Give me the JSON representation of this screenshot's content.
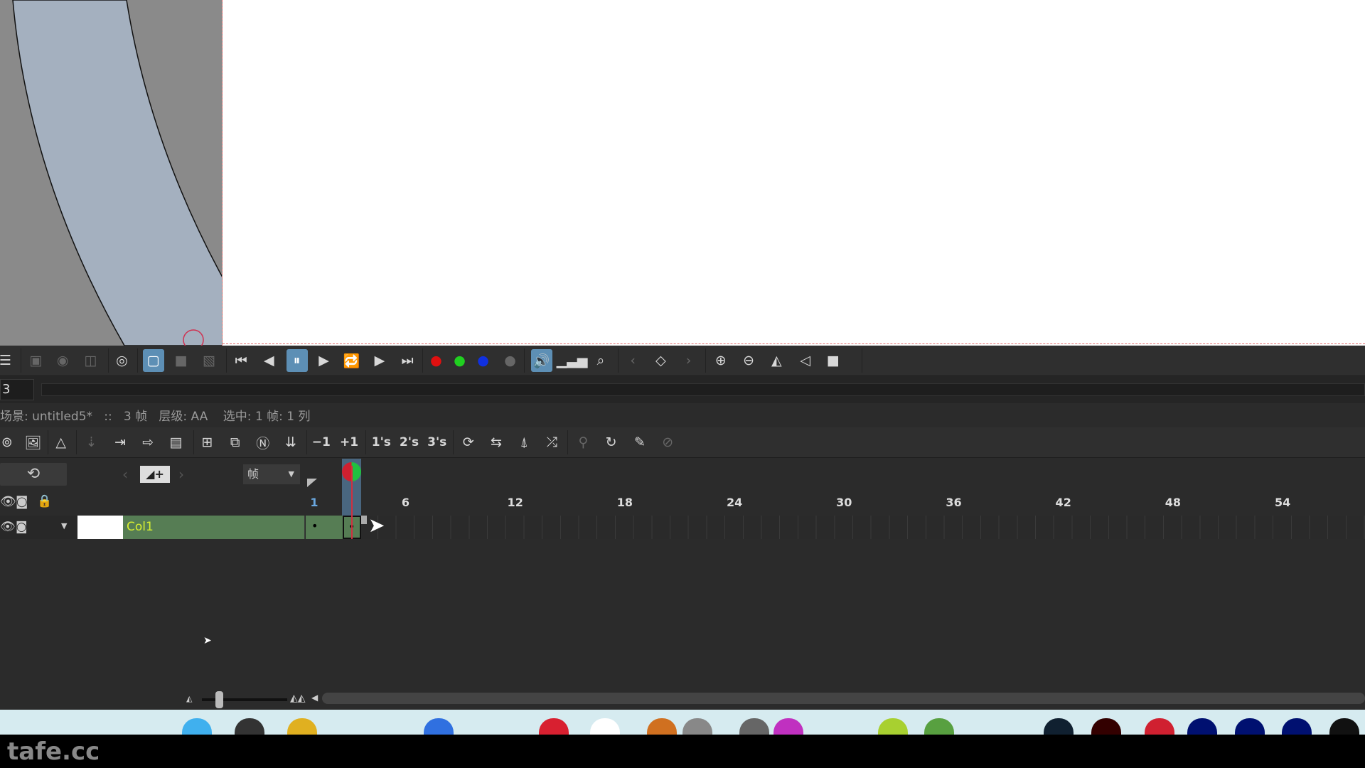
{
  "toolbar_main": [
    {
      "icon": "menu-icon",
      "g": "☰"
    },
    {
      "icon": "save-icon",
      "g": "▣",
      "dim": true
    },
    {
      "icon": "camera-icon",
      "g": "◉",
      "dim": true
    },
    {
      "icon": "compare-icon",
      "g": "◫",
      "dim": true
    },
    {
      "icon": "preview-icon",
      "g": "◎"
    },
    {
      "icon": "camera-view-icon",
      "g": "▢",
      "active": true,
      "dim": true
    },
    {
      "icon": "square-icon",
      "g": "■",
      "dim": true
    },
    {
      "icon": "sub-camera-icon",
      "g": "▧",
      "dim": true
    },
    {
      "icon": "first-frame-icon",
      "g": "⏮"
    },
    {
      "icon": "prev-frame-icon",
      "g": "◀"
    },
    {
      "icon": "pause-icon",
      "g": "⏸",
      "active": true
    },
    {
      "icon": "play-icon",
      "g": "▶"
    },
    {
      "icon": "loop-icon",
      "g": "🔁"
    },
    {
      "icon": "next-frame-icon",
      "g": "▶"
    },
    {
      "icon": "last-frame-icon",
      "g": "⏭"
    },
    {
      "icon": "red-channel-icon",
      "g": "●",
      "color": "#e01010"
    },
    {
      "icon": "green-channel-icon",
      "g": "●",
      "color": "#20d020"
    },
    {
      "icon": "blue-channel-icon",
      "g": "●",
      "color": "#1030e0"
    },
    {
      "icon": "alpha-channel-icon",
      "g": "●",
      "dim": true
    },
    {
      "icon": "sound-icon",
      "g": "🔊",
      "active": true
    },
    {
      "icon": "histogram-icon",
      "g": "▁▃▅"
    },
    {
      "icon": "search-icon",
      "g": "⌕"
    },
    {
      "icon": "prev-key-icon",
      "g": "‹",
      "dim": true
    },
    {
      "icon": "key-icon",
      "g": "◇"
    },
    {
      "icon": "next-key-icon",
      "g": "›",
      "dim": true
    },
    {
      "icon": "zoom-in-icon",
      "g": "⊕"
    },
    {
      "icon": "zoom-out-icon",
      "g": "⊖"
    },
    {
      "icon": "flip-horizontal-icon",
      "g": "◭"
    },
    {
      "icon": "flip-vertical-icon",
      "g": "◁"
    },
    {
      "icon": "reset-view-icon",
      "g": "■"
    }
  ],
  "frame_field": "3",
  "status": "场景: untitled5*   ::   3 帧   层级: AA    选中: 1 帧: 1 列",
  "toolbar_timeline": [
    {
      "icon": "new-toonz-level-icon",
      "g": "⊚"
    },
    {
      "icon": "new-raster-level-icon",
      "g": "🖼"
    },
    {
      "icon": "new-vector-level-icon",
      "g": "△"
    },
    {
      "icon": "new-note-icon",
      "g": "⇣",
      "dim": true
    },
    {
      "icon": "import-icon",
      "g": "⇥"
    },
    {
      "icon": "export-icon",
      "g": "⇨"
    },
    {
      "icon": "level-settings-icon",
      "g": "▤"
    },
    {
      "icon": "add-frame-icon",
      "g": "⊞"
    },
    {
      "icon": "duplicate-icon",
      "g": "⧉"
    },
    {
      "icon": "renumber-icon",
      "g": "Ⓝ"
    },
    {
      "icon": "reverse-icon",
      "g": "⇊"
    },
    {
      "icon": "decrement-icon",
      "t": "−1"
    },
    {
      "icon": "increment-icon",
      "t": "+1"
    },
    {
      "icon": "step-1-icon",
      "t": "1's"
    },
    {
      "icon": "step-2-icon",
      "t": "2's"
    },
    {
      "icon": "step-3-icon",
      "t": "3's"
    },
    {
      "icon": "rotate-icon",
      "g": "⟳"
    },
    {
      "icon": "swing-icon",
      "g": "⇆"
    },
    {
      "icon": "random-icon",
      "g": "⍋"
    },
    {
      "icon": "shuffle-icon",
      "g": "⤮"
    },
    {
      "icon": "autoinput-icon",
      "g": "⚲",
      "dim": true
    },
    {
      "icon": "refresh-icon",
      "g": "↻"
    },
    {
      "icon": "magic-icon",
      "g": "✎"
    },
    {
      "icon": "clear-icon",
      "g": "⊘",
      "dim": true
    }
  ],
  "timeline": {
    "frame_unit": "帧",
    "layer_name": "Col1",
    "frame_numbers": [
      "1",
      "6",
      "12",
      "18",
      "24",
      "30",
      "36",
      "42",
      "48",
      "54"
    ],
    "current_frame": 3,
    "exposed_frames": 3
  },
  "watermark": "tafe.cc"
}
